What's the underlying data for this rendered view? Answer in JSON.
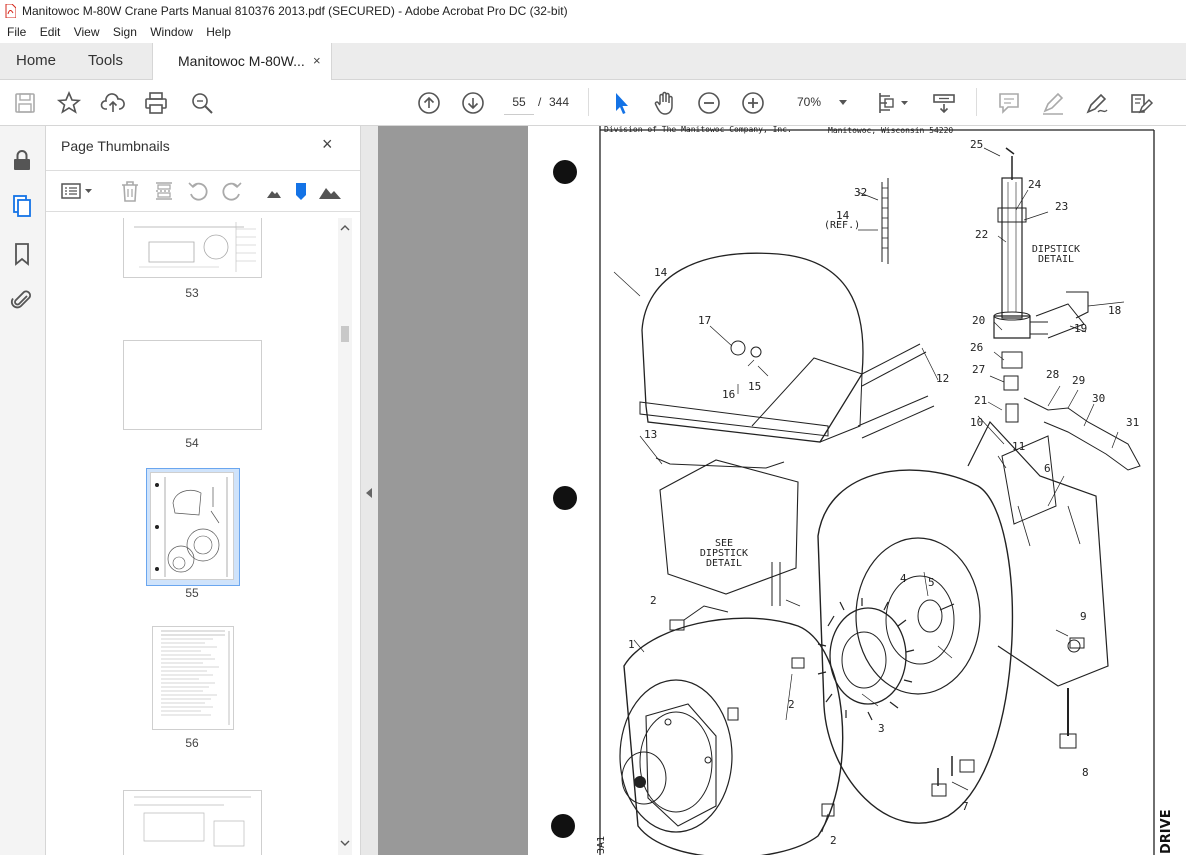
{
  "window": {
    "title": "Manitowoc M-80W Crane Parts Manual 810376 2013.pdf (SECURED) - Adobe Acrobat Pro DC (32-bit)"
  },
  "menu": [
    "File",
    "Edit",
    "View",
    "Sign",
    "Window",
    "Help"
  ],
  "tabs": {
    "home": "Home",
    "tools": "Tools",
    "doc": "Manitowoc M-80W...",
    "close": "×"
  },
  "toolbar": {
    "page_current": "55",
    "page_sep": "/",
    "page_total": "344",
    "zoom": "70%"
  },
  "panel": {
    "title": "Page Thumbnails",
    "close": "×"
  },
  "thumbnails": [
    {
      "label": "53"
    },
    {
      "label": "54"
    },
    {
      "label": "55",
      "selected": true
    },
    {
      "label": "56"
    }
  ],
  "document": {
    "header_left": "Division of The Manitowoc Company, Inc.",
    "header_right": "Manitowoc, Wisconsin 54220",
    "callouts": [
      "25",
      "24",
      "23",
      "22",
      "32",
      "14",
      "14",
      "(REF.)",
      "17",
      "16",
      "15",
      "12",
      "13",
      "10",
      "11",
      "20",
      "26",
      "27",
      "28",
      "29",
      "21",
      "30",
      "31",
      "19",
      "18",
      "6",
      "4",
      "5",
      "2",
      "2",
      "2",
      "1",
      "3",
      "9",
      "8",
      "7"
    ],
    "dipstick_detail": [
      "DIPSTICK",
      "DETAIL"
    ],
    "see_dipstick": [
      "SEE",
      "DIPSTICK",
      "DETAIL"
    ],
    "side_text": "DRIVE",
    "side_left": "3A1"
  },
  "colors": {
    "accent": "#1473e6",
    "viewer_bg": "#999999"
  }
}
